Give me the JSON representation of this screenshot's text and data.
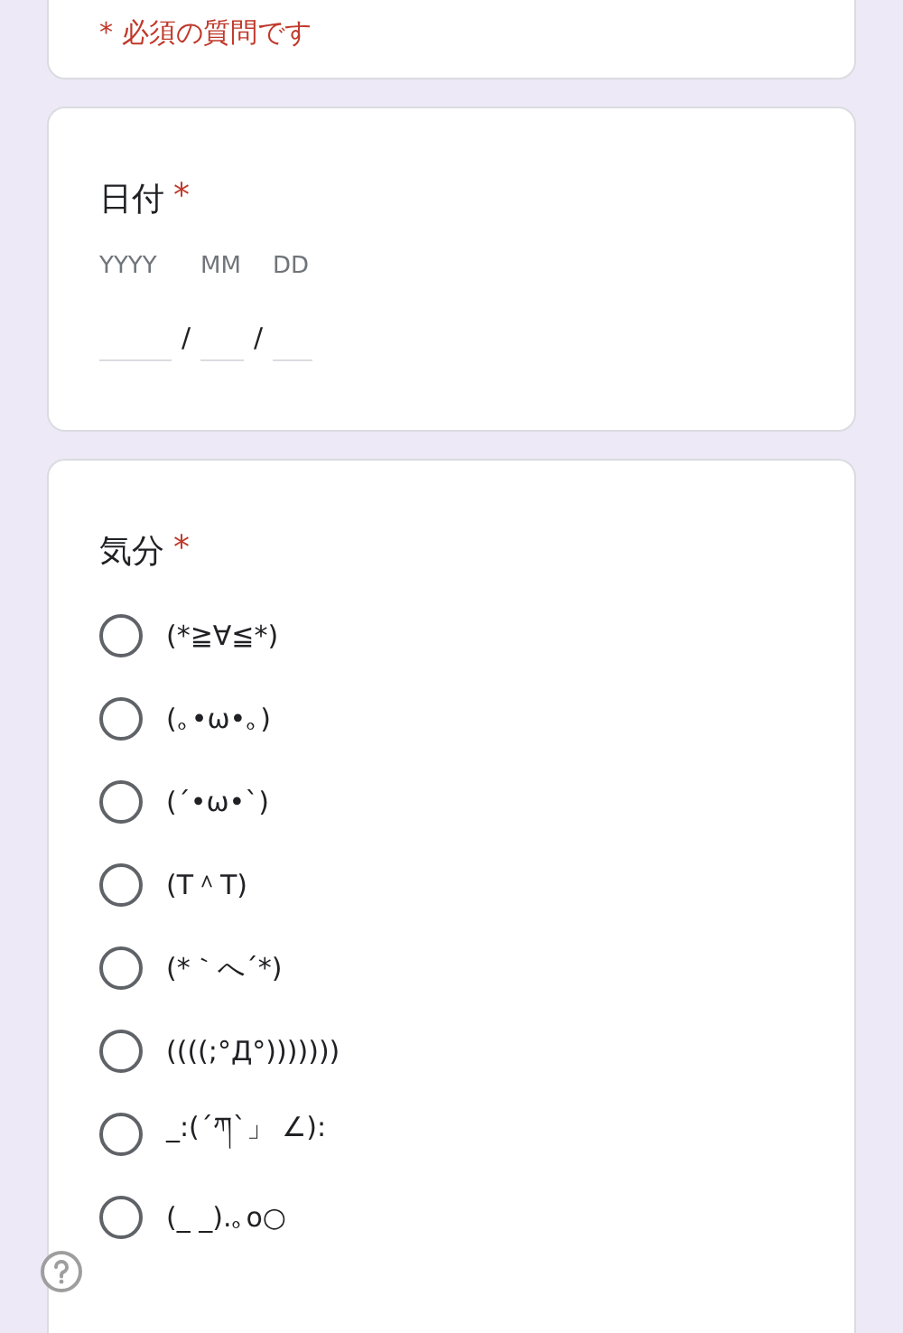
{
  "required_note": {
    "mark": "*",
    "text": "必須の質問です"
  },
  "date_question": {
    "title": "日付",
    "required_mark": "*",
    "fields": [
      {
        "label": "YYYY",
        "separator": "/"
      },
      {
        "label": "MM",
        "separator": "/"
      },
      {
        "label": "DD"
      }
    ]
  },
  "mood_question": {
    "title": "気分",
    "required_mark": "*",
    "options": [
      {
        "label": "(*≧∀≦*)",
        "selected": false
      },
      {
        "label": "(｡•ω•｡)",
        "selected": false
      },
      {
        "label": "(´•ω•`)",
        "selected": false
      },
      {
        "label": "(T＾T)",
        "selected": false
      },
      {
        "label": "(*｀へ´*)",
        "selected": false
      },
      {
        "label": "((((;°Д°)))))))",
        "selected": false
      },
      {
        "label": "_:(´ཀ`」 ∠):",
        "selected": false
      },
      {
        "label": "(_ _).｡o○",
        "selected": false
      }
    ]
  }
}
